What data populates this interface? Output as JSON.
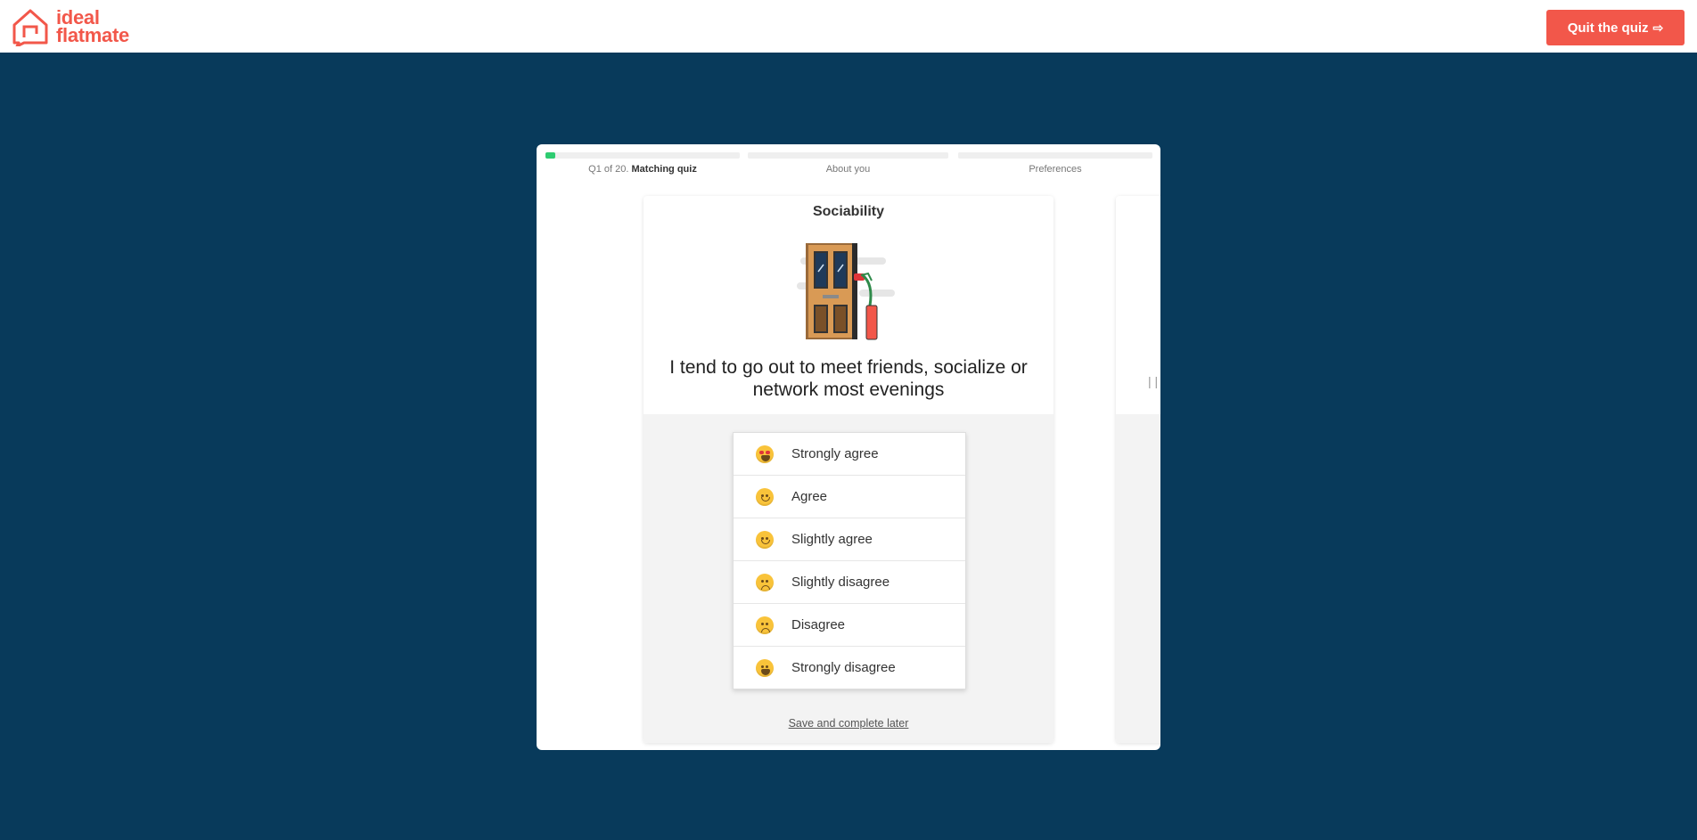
{
  "header": {
    "logo_line1": "ideal",
    "logo_line2": "flatmate",
    "quit_label": "Quit the quiz",
    "quit_icon": "sign-out-icon"
  },
  "progress": {
    "steps": [
      {
        "prefix": "Q1 of 20.",
        "label": "Matching quiz",
        "fill_fraction": 0.05
      },
      {
        "prefix": "",
        "label": "About you",
        "fill_fraction": 0
      },
      {
        "prefix": "",
        "label": "Preferences",
        "fill_fraction": 0
      }
    ],
    "fill_color": "#2ecc71"
  },
  "card": {
    "category": "Sociability",
    "illustration": "door-with-party-popper",
    "question": "I tend to go out to meet friends, socialize or network most evenings",
    "answers": [
      {
        "label": "Strongly agree",
        "icon": "heart-eyes-emoji-icon"
      },
      {
        "label": "Agree",
        "icon": "relieved-emoji-icon"
      },
      {
        "label": "Slightly agree",
        "icon": "slight-smile-emoji-icon"
      },
      {
        "label": "Slightly disagree",
        "icon": "slight-frown-emoji-icon"
      },
      {
        "label": "Disagree",
        "icon": "frown-emoji-icon"
      },
      {
        "label": "Strongly disagree",
        "icon": "tired-emoji-icon"
      }
    ],
    "save_link": "Save and complete later"
  },
  "next_card": {
    "text": "| |"
  },
  "colors": {
    "background": "#083a5b",
    "brand": "#f2574a"
  }
}
